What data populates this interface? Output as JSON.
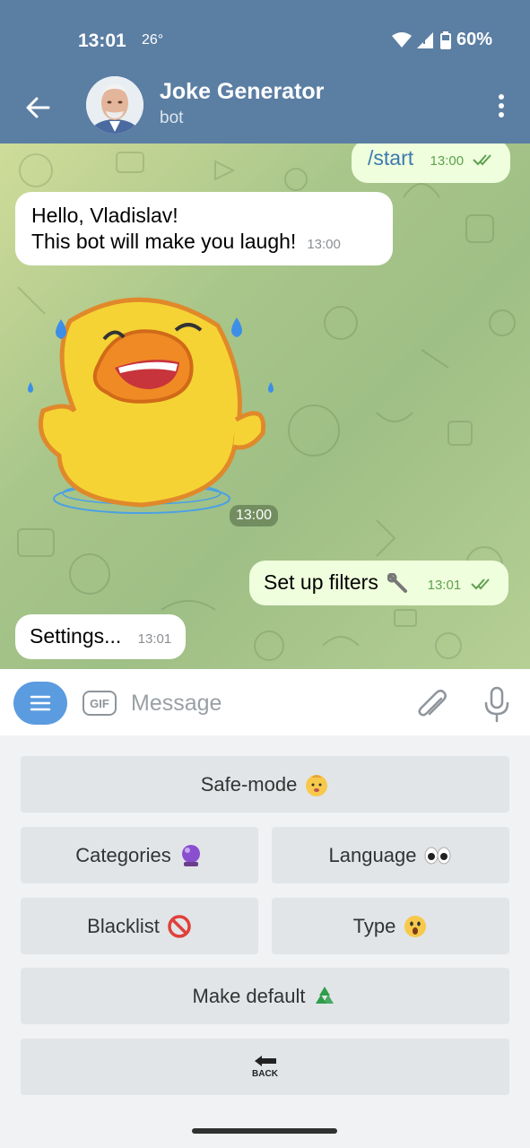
{
  "status_bar": {
    "time": "13:01",
    "temp": "26°",
    "battery": "60%"
  },
  "header": {
    "title": "Joke Generator",
    "subtitle": "bot"
  },
  "messages": [
    {
      "text": "/start",
      "time": "13:00"
    },
    {
      "line1": "Hello, Vladislav!",
      "line2": "This bot will make you laugh!",
      "time": "13:00"
    },
    {
      "time": "13:00"
    },
    {
      "text": "Set up filters",
      "time": "13:01"
    },
    {
      "text": "Settings...",
      "time": "13:01"
    }
  ],
  "input": {
    "gif_label": "GIF",
    "placeholder": "Message"
  },
  "keyboard": {
    "safe_mode": "Safe-mode",
    "categories": "Categories",
    "language": "Language",
    "blacklist": "Blacklist",
    "type": "Type",
    "make_default": "Make default",
    "back": "BACK"
  },
  "icons": [
    "back-arrow-icon",
    "more-vert-icon",
    "double-check-icon",
    "wrench-icon",
    "menu-icon",
    "gif-icon",
    "paperclip-icon",
    "mic-icon",
    "baby-emoji",
    "crystal-ball-emoji",
    "eyes-emoji",
    "prohibited-emoji",
    "hushed-face-emoji",
    "recycle-emoji",
    "back-arrow-emoji"
  ],
  "colors": {
    "header": "#5b7ea3",
    "outgoing_bubble": "#effedd",
    "accent": "#5b9be0",
    "keyboard_button": "#e1e5e8"
  }
}
